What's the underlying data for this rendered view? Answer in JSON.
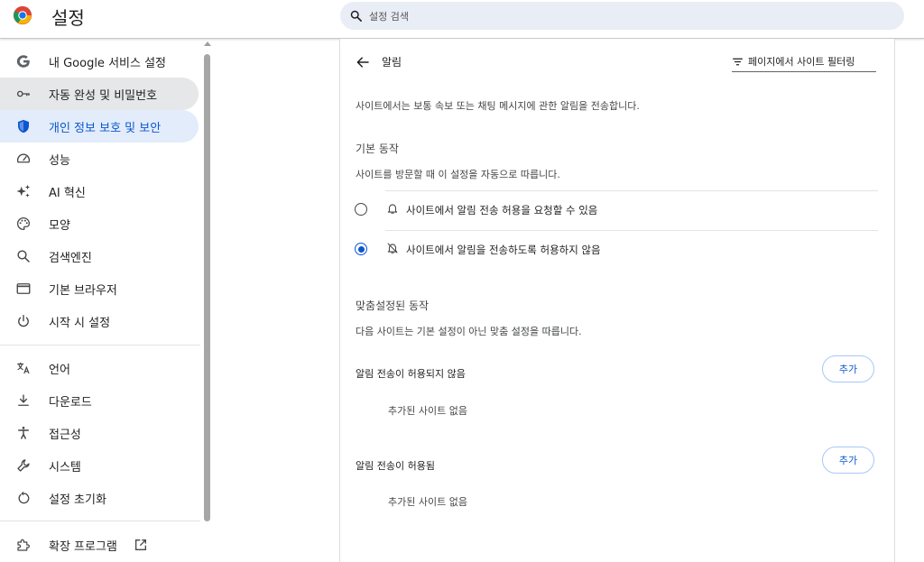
{
  "header": {
    "app_title": "설정",
    "search_placeholder": "설정 검색"
  },
  "sidebar": {
    "items": [
      {
        "label": "내 Google 서비스 설정",
        "icon": "google-g-icon"
      },
      {
        "label": "자동 완성 및 비밀번호",
        "icon": "key-icon"
      },
      {
        "label": "개인 정보 보호 및 보안",
        "icon": "shield-icon"
      },
      {
        "label": "성능",
        "icon": "speedometer-icon"
      },
      {
        "label": "AI 혁신",
        "icon": "sparkle-icon"
      },
      {
        "label": "모양",
        "icon": "palette-icon"
      },
      {
        "label": "검색엔진",
        "icon": "search-icon"
      },
      {
        "label": "기본 브라우저",
        "icon": "browser-window-icon"
      },
      {
        "label": "시작 시 설정",
        "icon": "power-icon"
      },
      {
        "label": "언어",
        "icon": "translate-icon"
      },
      {
        "label": "다운로드",
        "icon": "download-icon"
      },
      {
        "label": "접근성",
        "icon": "accessibility-icon"
      },
      {
        "label": "시스템",
        "icon": "wrench-icon"
      },
      {
        "label": "설정 초기화",
        "icon": "reset-icon"
      },
      {
        "label": "확장 프로그램",
        "icon": "puzzle-icon"
      }
    ],
    "active_index": 2,
    "hover_index": 1
  },
  "main": {
    "title": "알림",
    "filter_placeholder": "페이지에서 사이트 필터링",
    "description": "사이트에서는 보통 속보 또는 채팅 메시지에 관한 알림을 전송합니다.",
    "default_behavior": {
      "heading": "기본 동작",
      "description": "사이트를 방문할 때 이 설정을 자동으로 따릅니다.",
      "options": [
        {
          "label": "사이트에서 알림 전송 허용을 요청할 수 있음",
          "icon": "bell-icon",
          "checked": false
        },
        {
          "label": "사이트에서 알림을 전송하도록 허용하지 않음",
          "icon": "bell-off-icon",
          "checked": true
        }
      ]
    },
    "custom_behavior": {
      "heading": "맞춤설정된 동작",
      "description": "다음 사이트는 기본 설정이 아닌 맞춤 설정을 따릅니다.",
      "lists": [
        {
          "title": "알림 전송이 허용되지 않음",
          "button": "추가",
          "empty": "추가된 사이트 없음"
        },
        {
          "title": "알림 전송이 허용됨",
          "button": "추가",
          "empty": "추가된 사이트 없음"
        }
      ]
    }
  },
  "colors": {
    "accent": "#0b57d0",
    "active_bg": "#e3ecfa",
    "search_bg": "#e9eef6"
  }
}
